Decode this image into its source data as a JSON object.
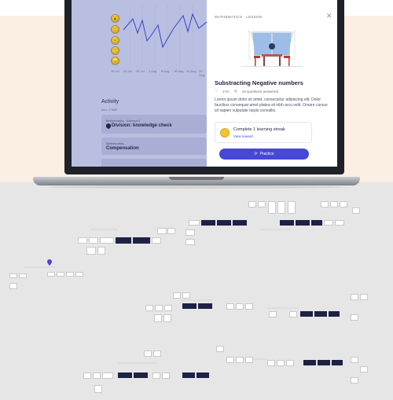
{
  "app": {
    "chart": {
      "x_ticks": [
        "16 Jul",
        "20 Jul",
        "26 Jul",
        "1 Aug",
        "8 Aug",
        "15 Aug",
        "22 Aug",
        "29 Aug"
      ],
      "moods": [
        "😮",
        "🙂",
        "😐",
        "🙁",
        "😞"
      ]
    },
    "activity": {
      "title": "Activity",
      "filter": "ALL-TIME",
      "cards": [
        {
          "kicker": "Mathematics · Attempt 2",
          "title": "Division: knowledge check",
          "icon": "shield-icon"
        },
        {
          "kicker": "Mathematics",
          "title": "Compensation"
        },
        {
          "kicker": "",
          "title": ""
        }
      ]
    }
  },
  "panel": {
    "kicker": "MATHEMATICS · LESSON",
    "close_icon": "✕",
    "title": "Substracting Negative numbers",
    "duration": "17m",
    "questions": "18 questions answered",
    "body": "Lorem ipsum dolor sit amet, consectetur adipiscing elit. Dolor faucibus consequat amet platea sit nibh arcu velit. Ornare cursus sit sapien vulputate turpis convallis.",
    "streak": {
      "title": "Complete 1 learning streak",
      "link": "View reward"
    },
    "button_label": "Practice"
  },
  "colors": {
    "accent": "#4747d8",
    "hero_bg": "#fbeee3",
    "dim_overlay": "#b9bfe0"
  }
}
